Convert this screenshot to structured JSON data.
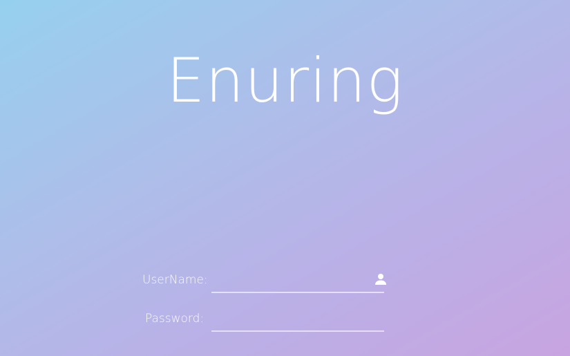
{
  "app": {
    "title": "Enuring"
  },
  "login": {
    "username_label": "UserName:",
    "username_value": "",
    "password_label": "Password:",
    "password_value": ""
  },
  "icons": {
    "username_icon": "person-icon"
  },
  "colors": {
    "gradient_start": "#96d0ef",
    "gradient_end": "#c8a4e0",
    "text": "#ffffff"
  }
}
